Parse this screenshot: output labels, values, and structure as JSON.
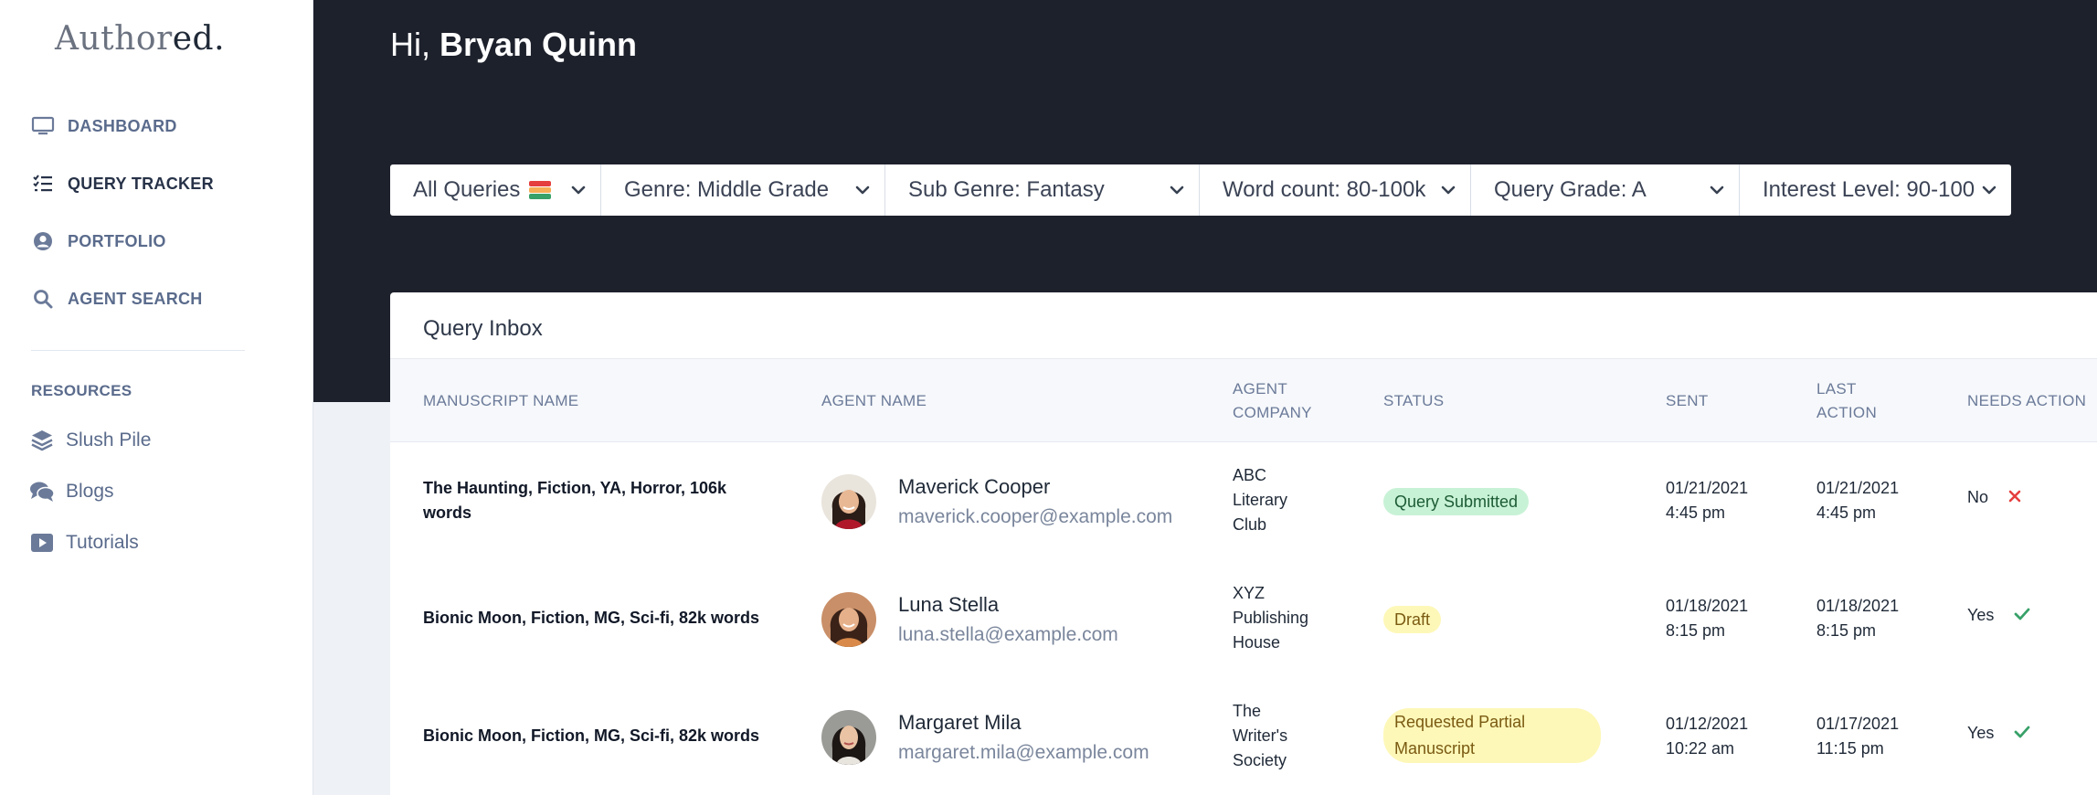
{
  "app": {
    "logo_main": "Author",
    "logo_suffix": "ed."
  },
  "sidebar": {
    "items": [
      {
        "label": "DASHBOARD",
        "icon": "monitor-icon"
      },
      {
        "label": "QUERY TRACKER",
        "icon": "list-check-icon",
        "active": true
      },
      {
        "label": "PORTFOLIO",
        "icon": "user-circle-icon"
      },
      {
        "label": "AGENT SEARCH",
        "icon": "search-icon"
      }
    ],
    "resources_heading": "RESOURCES",
    "resources": [
      {
        "label": "Slush Pile",
        "icon": "layers-icon"
      },
      {
        "label": "Blogs",
        "icon": "comments-icon"
      },
      {
        "label": "Tutorials",
        "icon": "youtube-icon"
      }
    ]
  },
  "header": {
    "greeting_prefix": "Hi,",
    "user_name": "Bryan Quinn"
  },
  "filters": [
    {
      "label": "All Queries"
    },
    {
      "label": "Genre: Middle Grade"
    },
    {
      "label": "Sub Genre: Fantasy"
    },
    {
      "label": "Word count: 80-100k"
    },
    {
      "label": "Query Grade: A"
    },
    {
      "label": "Interest Level: 90-100"
    }
  ],
  "inbox": {
    "title": "Query Inbox",
    "columns": {
      "manuscript": "MANUSCRIPT NAME",
      "agent": "AGENT NAME",
      "company_1": "AGENT",
      "company_2": "COMPANY",
      "status": "STATUS",
      "sent": "SENT",
      "last_1": "LAST",
      "last_2": "ACTION",
      "needs": "NEEDS ACTION"
    },
    "rows": [
      {
        "manuscript_1": "The Haunting, Fiction, YA, Horror, 106k",
        "manuscript_2": "words",
        "agent_name": "Maverick Cooper",
        "agent_email": "maverick.cooper@example.com",
        "company_1": "ABC",
        "company_2": "Literary",
        "company_3": "Club",
        "status": "Query Submitted",
        "sent_date": "01/21/2021",
        "sent_time": "4:45 pm",
        "last_date": "01/21/2021",
        "last_time": "4:45 pm",
        "needs_action": "No"
      },
      {
        "manuscript_1": "Bionic Moon, Fiction, MG, Sci-fi, 82k words",
        "agent_name": "Luna Stella",
        "agent_email": "luna.stella@example.com",
        "company_1": "XYZ",
        "company_2": "Publishing",
        "company_3": "House",
        "status": "Draft",
        "sent_date": "01/18/2021",
        "sent_time": "8:15 pm",
        "last_date": "01/18/2021",
        "last_time": "8:15 pm",
        "needs_action": "Yes"
      },
      {
        "manuscript_1": "Bionic Moon, Fiction, MG, Sci-fi, 82k words",
        "agent_name": "Margaret Mila",
        "agent_email": "margaret.mila@example.com",
        "company_1": "The",
        "company_2": "Writer's",
        "company_3": "Society",
        "status_1": "Requested Partial",
        "status_2": "Manuscript",
        "sent_date": "01/12/2021",
        "sent_time": "10:22 am",
        "last_date": "01/17/2021",
        "last_time": "11:15 pm",
        "needs_action": "Yes"
      }
    ]
  },
  "colors": {
    "header_bg": "#1d212c",
    "sidebar_bg": "#ffffff",
    "badge_green": "#c8f2d6",
    "badge_yellow": "#fdf8b8",
    "check_green": "#38a169",
    "cross_red": "#e53e3e"
  }
}
